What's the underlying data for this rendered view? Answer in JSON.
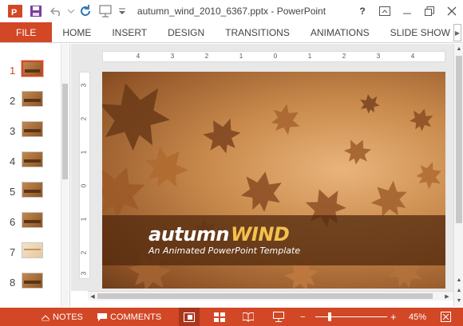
{
  "window": {
    "title": "autumn_wind_2010_6367.pptx - PowerPoint",
    "help_label": "?"
  },
  "ribbon": {
    "tabs": [
      "FILE",
      "HOME",
      "INSERT",
      "DESIGN",
      "TRANSITIONS",
      "ANIMATIONS",
      "SLIDE SHOW"
    ]
  },
  "thumbnails": {
    "selected": 1,
    "numbers": [
      "1",
      "2",
      "3",
      "4",
      "5",
      "6",
      "7",
      "8"
    ]
  },
  "ruler": {
    "horizontal": [
      "4",
      "3",
      "2",
      "1",
      "0",
      "1",
      "2",
      "3",
      "4"
    ],
    "vertical": [
      "3",
      "2",
      "1",
      "0",
      "1",
      "2",
      "3"
    ]
  },
  "slide": {
    "title_part1": "autumn",
    "title_part2": "WIND",
    "subtitle": "An Animated PowerPoint Template"
  },
  "status": {
    "notes_label": "NOTES",
    "comments_label": "COMMENTS",
    "zoom_minus": "−",
    "zoom_plus": "+",
    "zoom_level": "45%",
    "zoom_fraction": 0.45
  },
  "colors": {
    "accent": "#d24726",
    "title_highlight": "#f4c04e"
  }
}
